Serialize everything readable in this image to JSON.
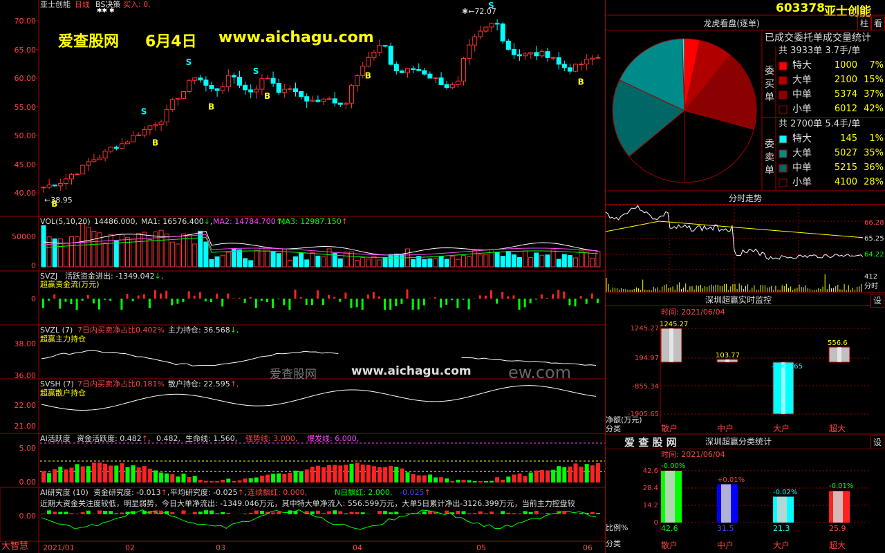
{
  "kline": {
    "stock_name": "亚士创能",
    "period": "日线",
    "bs_label": "BS决策",
    "buy_label": "买入: 0,",
    "high_label": "72.07",
    "low_label": "38.95",
    "y_ticks": [
      "70.00",
      "65.00",
      "60.00",
      "55.00",
      "50.00",
      "45.00",
      "40.00"
    ],
    "watermark": {
      "site": "爱查股网",
      "date": "6月4日",
      "url": "www.aichagu.com"
    }
  },
  "vol": {
    "title": "VOL(5,10,20)",
    "v": "14486.000",
    "ma1": "MA1: 16576.400",
    "ma2": "MA2: 14784.700",
    "ma3": "MA3: 12987.150",
    "arrow_down": "↓",
    "arrow_up": "↑",
    "ticks": [
      "50000",
      "0"
    ]
  },
  "svzj": {
    "title": "SVZJ",
    "desc": "活跃资金进出: -1349.042",
    "arrow": "↓,",
    "sub": "超赢资金流(万元)",
    "tick": "0"
  },
  "svzl": {
    "title": "SVZL (7)",
    "desc": "7日内买卖净占比0.402%",
    "extra": "主力持仓: 36.568",
    "arrow": "↓,",
    "sub": "超赢主力持仓",
    "ticks": [
      "38.00",
      "36.00"
    ],
    "wm1": "爱查股网",
    "wm2": "www.aichagu.com",
    "wm3": "ew.com"
  },
  "svsh": {
    "title": "SVSH (7)",
    "desc": "7日内买卖净占比0.181%",
    "extra": "散户持仓: 22.595",
    "arrow": "↑,",
    "sub": "超赢散户持仓",
    "ticks": [
      "22.00",
      "21.00"
    ]
  },
  "ai_act": {
    "title": "AI活跃度",
    "a": "资金活跃度: 0.482",
    "b": "0.482",
    "c": "生命线: 1.560,",
    "d": "强势线: 3.000,",
    "e": "爆发线: 6.000,",
    "ticks": [
      "5.00",
      "0.00"
    ]
  },
  "ai_res": {
    "title": "AI研究度 (10)",
    "a": "资金研究度: -0.013",
    "b": "平均研究度: -0.025",
    "c": "连续飘红: 0.000,",
    "d": "N日飘红: 2.000,",
    "e": "-0.025",
    "text": "近期大资金关注度较低，明显弱势，今日大单净流出: -1349.046万元，其中特大单净流入: 556.599万元，大单5日累计净出-3126.399万元，当前主力控盘较",
    "tick": "0.00"
  },
  "bottom": {
    "logo": "大智慧",
    "dates": [
      "2021/01",
      "02",
      "03",
      "04",
      "05",
      "06"
    ]
  },
  "right": {
    "code": "603378",
    "name": "亚士创能",
    "btn1": "柱",
    "btn2": "看",
    "pie_title": "龙虎看盘(逐单)",
    "stat_title": "已成交委托单成交量统计",
    "buy": {
      "header": "共 3933单 3.7手/单",
      "label": [
        "委",
        "买",
        "单"
      ],
      "rows": [
        {
          "name": "特大",
          "num": "1000",
          "pct": "7%"
        },
        {
          "name": "大单",
          "num": "2100",
          "pct": "15%"
        },
        {
          "name": "中单",
          "num": "5374",
          "pct": "37%"
        },
        {
          "name": "小单",
          "num": "6012",
          "pct": "42%"
        }
      ]
    },
    "sell": {
      "header": "共 2700单 5.4手/单",
      "label": [
        "委",
        "卖",
        "单"
      ],
      "rows": [
        {
          "name": "特大",
          "num": "145",
          "pct": "1%"
        },
        {
          "name": "大单",
          "num": "5027",
          "pct": "35%"
        },
        {
          "name": "中单",
          "num": "5215",
          "pct": "36%"
        },
        {
          "name": "小单",
          "num": "4100",
          "pct": "28%"
        }
      ]
    },
    "fenshi_title": "分时走势",
    "fenshi_ticks": [
      "66.28",
      "65.25",
      "64.22",
      "412",
      "分时"
    ],
    "mon_title": "深圳超赢实时监控",
    "mon_time": "时间: 2021/06/04",
    "mon_btn": "设",
    "mon_ticks": [
      "1245.27",
      "194.97",
      "-855.34",
      "-1905.65"
    ],
    "mon_vals": [
      "1245.27",
      "103.77",
      "-1905.65",
      "556.6"
    ],
    "mon_ylabel": "净额(万元)",
    "mon_xlabel": "分类",
    "cats": [
      "散户",
      "中户",
      "大户",
      "超大"
    ],
    "cls_logo": "爱 查 股 网",
    "cls_title": "深圳超赢分类统计",
    "cls_time": "时间: 2021/06/04",
    "cls_btn": "设",
    "cls_ticks": [
      "42.6",
      "28.4",
      "14.2",
      "0"
    ],
    "cls_top": [
      "-0.00%",
      "+0.01%",
      "-0.02%",
      "-0.01%"
    ],
    "cls_vals": [
      "42.6",
      "31.5",
      "21.3",
      "25.9"
    ],
    "cls_ylabel": "比例%",
    "cls_xlabel": "分类"
  },
  "chart_data": [
    {
      "type": "pie",
      "title": "龙虎看盘(逐单)",
      "slices": [
        {
          "name": "委买特大",
          "value": 7,
          "color": "#ff0000"
        },
        {
          "name": "委买大单",
          "value": 15,
          "color": "#b00000"
        },
        {
          "name": "委买中单",
          "value": 37,
          "color": "#8b0000"
        },
        {
          "name": "委买小单",
          "value": 42,
          "color": "#000000"
        },
        {
          "name": "委卖特大",
          "value": 1,
          "color": "#00ffff"
        },
        {
          "name": "委卖大单",
          "value": 35,
          "color": "#008b8b"
        },
        {
          "name": "委卖中单",
          "value": 36,
          "color": "#006666"
        },
        {
          "name": "委卖小单",
          "value": 28,
          "color": "#000000"
        }
      ]
    },
    {
      "type": "bar",
      "title": "深圳超赢实时监控",
      "categories": [
        "散户",
        "中户",
        "大户",
        "超大"
      ],
      "values": [
        1245.27,
        103.77,
        -1905.65,
        556.6
      ],
      "ylim": [
        -1905.65,
        1245.27
      ]
    },
    {
      "type": "bar",
      "title": "深圳超赢分类统计",
      "categories": [
        "散户",
        "中户",
        "大户",
        "超大"
      ],
      "values": [
        42.6,
        31.5,
        21.3,
        25.9
      ],
      "ylim": [
        0,
        42.6
      ]
    }
  ]
}
